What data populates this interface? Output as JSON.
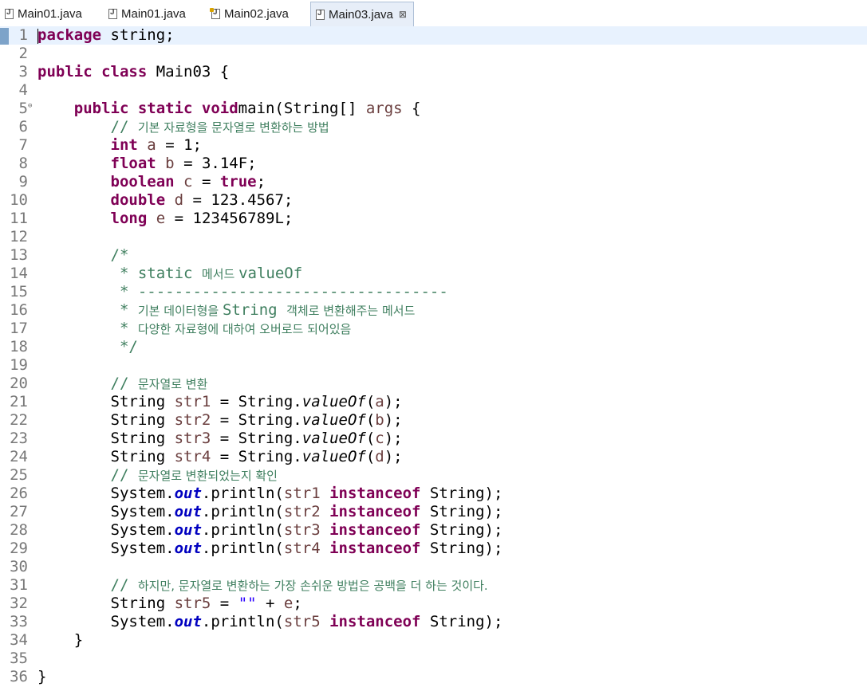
{
  "tabs": [
    {
      "label": "Main01.java",
      "icon": "java-file-icon",
      "active": false,
      "modified": false
    },
    {
      "label": "Main01.java",
      "icon": "java-file-icon",
      "active": false,
      "modified": false
    },
    {
      "label": "Main02.java",
      "icon": "java-file-icon",
      "active": false,
      "modified": true
    },
    {
      "label": "Main03.java",
      "icon": "java-file-icon",
      "active": true,
      "modified": false
    }
  ],
  "close_glyph": "⊠",
  "colors": {
    "keyword": "#7f0055",
    "comment": "#3f7f5f",
    "local_variable": "#6a3e3e",
    "static_field": "#0000c0",
    "string": "#2a00ff",
    "current_line": "#e8f2fe"
  },
  "lines": [
    [
      [
        "kw",
        "package"
      ],
      [
        "",
        "string;"
      ]
    ],
    [],
    [
      [
        "kw",
        "public class"
      ],
      [
        "",
        "Main03 {"
      ]
    ],
    [],
    [
      [
        "",
        "    "
      ],
      [
        "kw",
        "public static void"
      ],
      [
        "",
        "main(String[] "
      ],
      [
        "var",
        "args"
      ],
      [
        "",
        " {"
      ]
    ],
    [
      [
        "",
        "        "
      ],
      [
        "com",
        "// "
      ],
      [
        "comk",
        "기본 자료형을 문자열로 변환하는 방법"
      ]
    ],
    [
      [
        "",
        "        "
      ],
      [
        "kw",
        "int"
      ],
      [
        "",
        " "
      ],
      [
        "var",
        "a"
      ],
      [
        "",
        " = 1;"
      ]
    ],
    [
      [
        "",
        "        "
      ],
      [
        "kw",
        "float"
      ],
      [
        "",
        " "
      ],
      [
        "var",
        "b"
      ],
      [
        "",
        " = 3.14F;"
      ]
    ],
    [
      [
        "",
        "        "
      ],
      [
        "kw",
        "boolean"
      ],
      [
        "",
        " "
      ],
      [
        "var",
        "c"
      ],
      [
        "",
        " = "
      ],
      [
        "kw",
        "true"
      ],
      [
        "",
        ";"
      ]
    ],
    [
      [
        "",
        "        "
      ],
      [
        "kw",
        "double"
      ],
      [
        "",
        " "
      ],
      [
        "var",
        "d"
      ],
      [
        "",
        " = 123.4567;"
      ]
    ],
    [
      [
        "",
        "        "
      ],
      [
        "kw",
        "long"
      ],
      [
        "",
        " "
      ],
      [
        "var",
        "e"
      ],
      [
        "",
        " = 123456789L;"
      ]
    ],
    [],
    [
      [
        "",
        "        "
      ],
      [
        "com",
        "/*"
      ]
    ],
    [
      [
        "",
        "         "
      ],
      [
        "com",
        "* static "
      ],
      [
        "comk",
        "메서드 "
      ],
      [
        "com",
        "valueOf"
      ]
    ],
    [
      [
        "",
        "         "
      ],
      [
        "com",
        "* ----------------------------------"
      ]
    ],
    [
      [
        "",
        "         "
      ],
      [
        "com",
        "* "
      ],
      [
        "comk",
        "기본 데이터형을 "
      ],
      [
        "com",
        "String "
      ],
      [
        "comk",
        "객체로 변환해주는 메서드"
      ]
    ],
    [
      [
        "",
        "         "
      ],
      [
        "com",
        "* "
      ],
      [
        "comk",
        "다양한 자료형에 대하여 오버로드 되어있음"
      ]
    ],
    [
      [
        "",
        "         "
      ],
      [
        "com",
        "*/"
      ]
    ],
    [],
    [
      [
        "",
        "        "
      ],
      [
        "com",
        "// "
      ],
      [
        "comk",
        "문자열로 변환"
      ]
    ],
    [
      [
        "",
        "        String "
      ],
      [
        "var",
        "str1"
      ],
      [
        "",
        " = String."
      ],
      [
        "ital",
        "valueOf"
      ],
      [
        "",
        "("
      ],
      [
        "var",
        "a"
      ],
      [
        "",
        ");"
      ]
    ],
    [
      [
        "",
        "        String "
      ],
      [
        "var",
        "str2"
      ],
      [
        "",
        " = String."
      ],
      [
        "ital",
        "valueOf"
      ],
      [
        "",
        "("
      ],
      [
        "var",
        "b"
      ],
      [
        "",
        ");"
      ]
    ],
    [
      [
        "",
        "        String "
      ],
      [
        "var",
        "str3"
      ],
      [
        "",
        " = String."
      ],
      [
        "ital",
        "valueOf"
      ],
      [
        "",
        "("
      ],
      [
        "var",
        "c"
      ],
      [
        "",
        ");"
      ]
    ],
    [
      [
        "",
        "        String "
      ],
      [
        "var",
        "str4"
      ],
      [
        "",
        " = String."
      ],
      [
        "ital",
        "valueOf"
      ],
      [
        "",
        "("
      ],
      [
        "var",
        "d"
      ],
      [
        "",
        ");"
      ]
    ],
    [
      [
        "",
        "        "
      ],
      [
        "com",
        "// "
      ],
      [
        "comk",
        "문자열로 변환되었는지 확인"
      ]
    ],
    [
      [
        "",
        "        System."
      ],
      [
        "fld",
        "out"
      ],
      [
        "",
        ".println("
      ],
      [
        "var",
        "str1"
      ],
      [
        "",
        " "
      ],
      [
        "kw",
        "instanceof"
      ],
      [
        "",
        " String);"
      ]
    ],
    [
      [
        "",
        "        System."
      ],
      [
        "fld",
        "out"
      ],
      [
        "",
        ".println("
      ],
      [
        "var",
        "str2"
      ],
      [
        "",
        " "
      ],
      [
        "kw",
        "instanceof"
      ],
      [
        "",
        " String);"
      ]
    ],
    [
      [
        "",
        "        System."
      ],
      [
        "fld",
        "out"
      ],
      [
        "",
        ".println("
      ],
      [
        "var",
        "str3"
      ],
      [
        "",
        " "
      ],
      [
        "kw",
        "instanceof"
      ],
      [
        "",
        " String);"
      ]
    ],
    [
      [
        "",
        "        System."
      ],
      [
        "fld",
        "out"
      ],
      [
        "",
        ".println("
      ],
      [
        "var",
        "str4"
      ],
      [
        "",
        " "
      ],
      [
        "kw",
        "instanceof"
      ],
      [
        "",
        " String);"
      ]
    ],
    [],
    [
      [
        "",
        "        "
      ],
      [
        "com",
        "// "
      ],
      [
        "comk",
        "하지만, 문자열로 변환하는 가장 손쉬운 방법은 공백을 더 하는 것이다."
      ]
    ],
    [
      [
        "",
        "        String "
      ],
      [
        "var",
        "str5"
      ],
      [
        "",
        " = "
      ],
      [
        "str",
        "\"\""
      ],
      [
        "",
        " + "
      ],
      [
        "var",
        "e"
      ],
      [
        "",
        ";"
      ]
    ],
    [
      [
        "",
        "        System."
      ],
      [
        "fld",
        "out"
      ],
      [
        "",
        ".println("
      ],
      [
        "var",
        "str5"
      ],
      [
        "",
        " "
      ],
      [
        "kw",
        "instanceof"
      ],
      [
        "",
        " String);"
      ]
    ],
    [
      [
        "",
        "    }"
      ]
    ],
    [],
    [
      [
        "",
        "}"
      ]
    ]
  ]
}
